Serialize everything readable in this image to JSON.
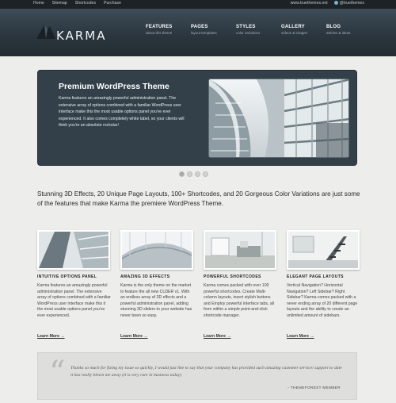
{
  "topbar": {
    "links": [
      "Home",
      "Sitemap",
      "Shortcodes",
      "Purchase"
    ],
    "website": "www.truethemes.net",
    "twitter": "@truethemes"
  },
  "header": {
    "logo": "KARMA",
    "nav": [
      {
        "title": "FEATURES",
        "subtitle": "about this theme"
      },
      {
        "title": "PAGES",
        "subtitle": "layout templates"
      },
      {
        "title": "STYLES",
        "subtitle": "color variations"
      },
      {
        "title": "GALLERY",
        "subtitle": "videos & images"
      },
      {
        "title": "BLOG",
        "subtitle": "articles & ideas"
      }
    ]
  },
  "slider": {
    "title": "Premium WordPress Theme",
    "body": "Karma features an amazingly powerful administration panel. The extensive array of options combined with a familiar WordPress user interface make this the most usable options panel you've ever experienced. It also comes completely white label, so your clients will think you're an absolute rockstar!"
  },
  "tagline": "Stunning 3D Effects, 20 Unique Page Layouts, 100+ Shortcodes, and 20 Gorgeous Color Variations are just some of the features that make Karma the premiere WordPress Theme.",
  "features": [
    {
      "title": "INTUITIVE OPTIONS PANEL",
      "body": "Karma features an amazingly powerful administration panel. The extensive array of options combined with a familiar WordPress user interface make this it the most usable options panel you've ever experienced.",
      "link": "Learn More →"
    },
    {
      "title": "AMAZING 3D EFFECTS",
      "body": "Karma is the only theme on the market to feature the all new CU3ER v1. With an endless array of 3D effects and a powerful administration panel, adding stunning 3D sliders to your website has never been so easy.",
      "link": "Learn More →"
    },
    {
      "title": "POWERFUL SHORTCODES",
      "body": "Karma comes packed with over 100 powerful shortcodes. Create Multi-column layouts, insert stylish buttons and Employ powerful interface tabs, all from within a simple point-and-click shortcode manager.",
      "link": "Learn More →"
    },
    {
      "title": "ELEGANT PAGE LAYOUTS",
      "body": "Vertical Navigation? Horizontal Navigation? Left Sidebar? Right Sidebar? Karma comes packed with a never ending array of 20 different page layouts and the ability to create an unlimited amount of sidebars.",
      "link": "Learn More →"
    }
  ],
  "testimonial": {
    "text": "Thanks so much for fixing my issue so quickly, I would just like to say that your company has provided such amazing customer service/ support to date it has really blown me away (it is very rare in business today)",
    "author": "- THEMEFOREST MEMBER"
  },
  "colors": {
    "header_dark": "#2a353d",
    "slider_bg": "#334049",
    "page_bg": "#ededeb"
  }
}
